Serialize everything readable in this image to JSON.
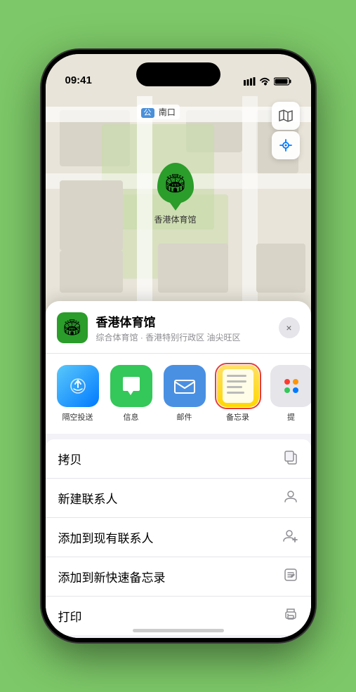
{
  "status_bar": {
    "time": "09:41",
    "signal": "▌▌▌",
    "wifi": "WiFi",
    "battery": "Battery"
  },
  "map": {
    "label_prefix": "南口",
    "stadium_name": "香港体育馆",
    "pin_emoji": "🏟"
  },
  "sheet": {
    "venue_name": "香港体育馆",
    "venue_desc": "综合体育馆 · 香港特别行政区 油尖旺区",
    "close_label": "×"
  },
  "share_items": [
    {
      "id": "airdrop",
      "label": "隔空投送"
    },
    {
      "id": "messages",
      "label": "信息"
    },
    {
      "id": "mail",
      "label": "邮件"
    },
    {
      "id": "notes",
      "label": "备忘录"
    },
    {
      "id": "more",
      "label": "提"
    }
  ],
  "actions": [
    {
      "label": "拷贝",
      "icon": "copy"
    },
    {
      "label": "新建联系人",
      "icon": "person"
    },
    {
      "label": "添加到现有联系人",
      "icon": "person-add"
    },
    {
      "label": "添加到新快速备忘录",
      "icon": "note"
    },
    {
      "label": "打印",
      "icon": "print"
    }
  ]
}
